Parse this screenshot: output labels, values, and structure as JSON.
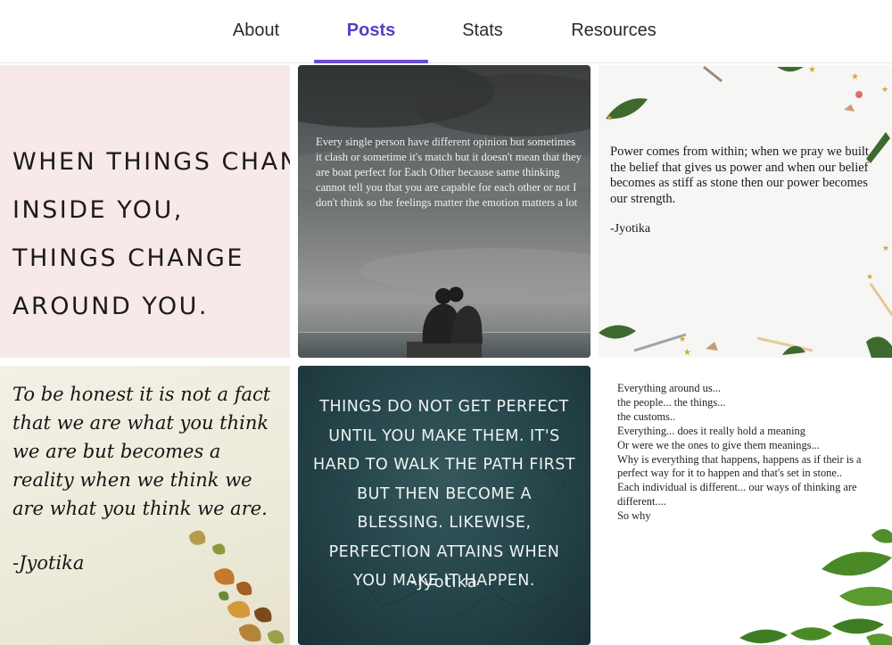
{
  "tabs": [
    {
      "label": "About",
      "active": false
    },
    {
      "label": "Posts",
      "active": true
    },
    {
      "label": "Stats",
      "active": false
    },
    {
      "label": "Resources",
      "active": false
    }
  ],
  "accent_color": "#5b3cc4",
  "posts": [
    {
      "lines": [
        "When things chan",
        "inside you,",
        "things change",
        "around you."
      ]
    },
    {
      "text": "Every single person have different opinion but sometimes it clash or sometime it's match but it doesn't mean that they are boat perfect for Each Other because same thinking cannot tell you that you are capable for each other or not I don't think so the feelings matter the emotion matters a lot"
    },
    {
      "text": "Power comes from within; when we pray we built the belief that gives us power and when our belief becomes as stiff as stone then our power becomes our strength.",
      "signature": "-Jyotika"
    },
    {
      "text": "To be honest it is not a fact that we are what you think we are but becomes a reality when we think we are what you think we are.",
      "signature": "-Jyotika"
    },
    {
      "text": "Things do not get perfect until you make them. It's hard to walk the path first but then become a blessing. Likewise, perfection attains when you make it happen.",
      "signature": "-Jyotika"
    },
    {
      "text": "Everything around us...\nthe people... the things...\nthe customs..\nEverything... does it really hold a meaning\nOr were we the ones to give them meanings...\nWhy is everything that happens, happens as if their is a perfect way for it to happen and that's set in stone..\nEach individual is different... our ways of thinking are different....\nSo why"
    }
  ]
}
